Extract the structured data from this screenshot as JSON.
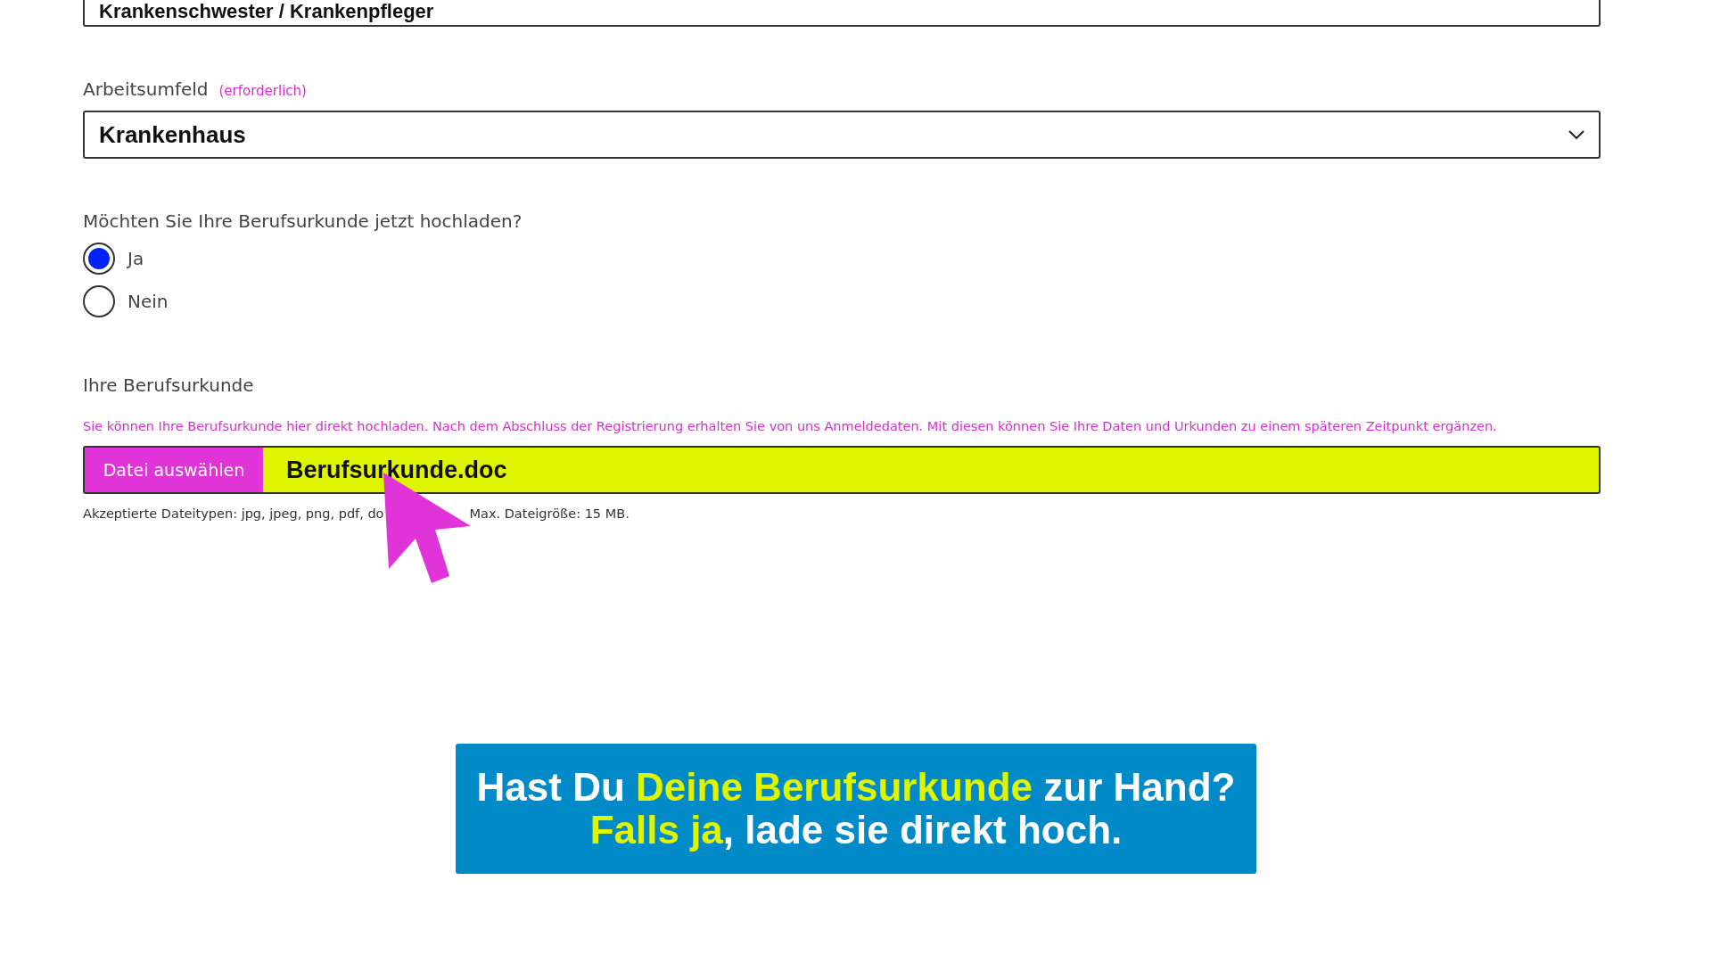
{
  "profession_field": {
    "value": "Krankenschwester / Krankenpfleger"
  },
  "work_environment": {
    "label": "Arbeitsumfeld",
    "required_note": "(erforderlich)",
    "value": "Krankenhaus"
  },
  "upload_question": {
    "label": "Möchten Sie Ihre Berufsurkunde jetzt hochladen?",
    "options": [
      {
        "label": "Ja",
        "selected": true
      },
      {
        "label": "Nein",
        "selected": false
      }
    ]
  },
  "certificate": {
    "label": "Ihre Berufsurkunde",
    "info": "Sie können Ihre Berufsurkunde hier direkt hochladen. Nach dem Abschluss der Registrierung erhalten Sie von uns Anmeldedaten. Mit diesen können Sie Ihre Daten und Urkunden zu einem späteren Zeitpunkt ergänzen.",
    "button": "Datei auswählen",
    "file_name": "Berufsurkunde.doc",
    "hint_parts": [
      "Akzeptierte Dateitypen: jpg, jpeg, png, pdf, do",
      "Max. Dateigröße: 15 MB."
    ]
  },
  "caption": {
    "lines": [
      "Hast Du **Deine Berufsurkunde** zur Hand?",
      "**Falls ja**, lade sie direkt hoch."
    ]
  }
}
